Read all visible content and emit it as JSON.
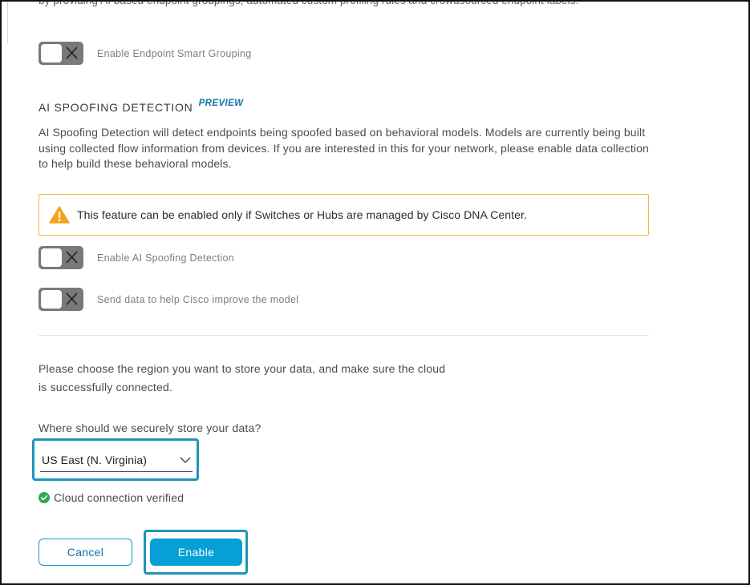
{
  "top_clipped_text": "by providing AI based endpoint groupings, automated custom profiling rules and crowdsourced endpoint labels.",
  "smart_grouping": {
    "label": "Enable Endpoint Smart Grouping",
    "enabled": false
  },
  "ai_spoofing": {
    "title": "AI SPOOFING DETECTION",
    "badge": "PREVIEW",
    "description": "AI Spoofing Detection will detect endpoints being spoofed based on behavioral models. Models are currently being built using collected flow information from devices. If you are interested in this for your network, please enable data collection to help build these behavioral models.",
    "warning": "This feature can be enabled only if Switches or Hubs are managed by Cisco DNA Center.",
    "toggle_detection": {
      "label": "Enable AI Spoofing Detection",
      "enabled": false
    },
    "toggle_send_data": {
      "label": "Send data to help Cisco improve the model",
      "enabled": false
    }
  },
  "region": {
    "instructions": "Please choose the region you want to store your data, and make sure the cloud is successfully connected.",
    "question": "Where should we securely store your data?",
    "selected": "US East (N. Virginia)",
    "status": "Cloud connection verified"
  },
  "buttons": {
    "cancel": "Cancel",
    "enable": "Enable"
  },
  "colors": {
    "accent": "#069fd6",
    "highlight": "#1e95b8",
    "warning": "#f1b43d",
    "success": "#2fa84f",
    "toggle_off": "#78797b"
  }
}
